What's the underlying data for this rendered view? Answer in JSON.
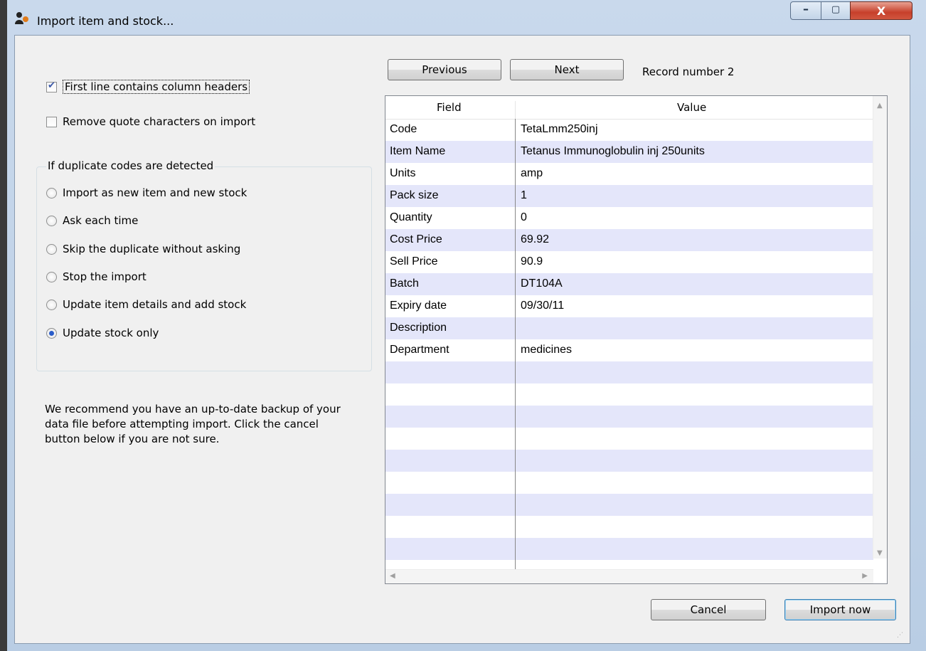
{
  "window": {
    "title": "Import item and stock...",
    "controls": {
      "minimize": "–",
      "maximize": "▢",
      "close": "X"
    }
  },
  "options": {
    "first_line_headers": {
      "label": "First line contains column headers",
      "checked": true
    },
    "remove_quotes": {
      "label": "Remove quote characters on import",
      "checked": false
    }
  },
  "duplicates": {
    "legend": "If duplicate codes are detected",
    "choices": [
      {
        "label": "Import as new item and new stock",
        "selected": false
      },
      {
        "label": "Ask each time",
        "selected": false
      },
      {
        "label": "Skip the duplicate without asking",
        "selected": false
      },
      {
        "label": "Stop the import",
        "selected": false
      },
      {
        "label": "Update item details and add stock",
        "selected": false
      },
      {
        "label": "Update stock only",
        "selected": true
      }
    ]
  },
  "warning_text": "We recommend you have an up-to-date backup of your data file before attempting import. Click the cancel button below if you are not sure.",
  "nav": {
    "previous": "Previous",
    "next": "Next",
    "record_label": "Record number 2"
  },
  "table": {
    "headers": [
      "Field",
      "Value"
    ],
    "rows": [
      [
        "Code",
        "TetaLmm250inj"
      ],
      [
        "Item Name",
        "Tetanus Immunoglobulin inj 250units"
      ],
      [
        "Units",
        "amp"
      ],
      [
        "Pack size",
        "1"
      ],
      [
        "Quantity",
        "0"
      ],
      [
        "Cost Price",
        "69.92"
      ],
      [
        "Sell Price",
        "90.9"
      ],
      [
        "Batch",
        "DT104A"
      ],
      [
        "Expiry date",
        "09/30/11"
      ],
      [
        "Description",
        ""
      ],
      [
        "Department",
        "medicines"
      ],
      [
        "",
        ""
      ],
      [
        "",
        ""
      ],
      [
        "",
        ""
      ],
      [
        "",
        ""
      ],
      [
        "",
        ""
      ],
      [
        "",
        ""
      ],
      [
        "",
        ""
      ],
      [
        "",
        ""
      ],
      [
        "",
        ""
      ]
    ]
  },
  "footer": {
    "cancel": "Cancel",
    "import": "Import now"
  },
  "colors": {
    "row_stripe": "#e4e6fa",
    "default_button_border": "#3c7fb1"
  }
}
